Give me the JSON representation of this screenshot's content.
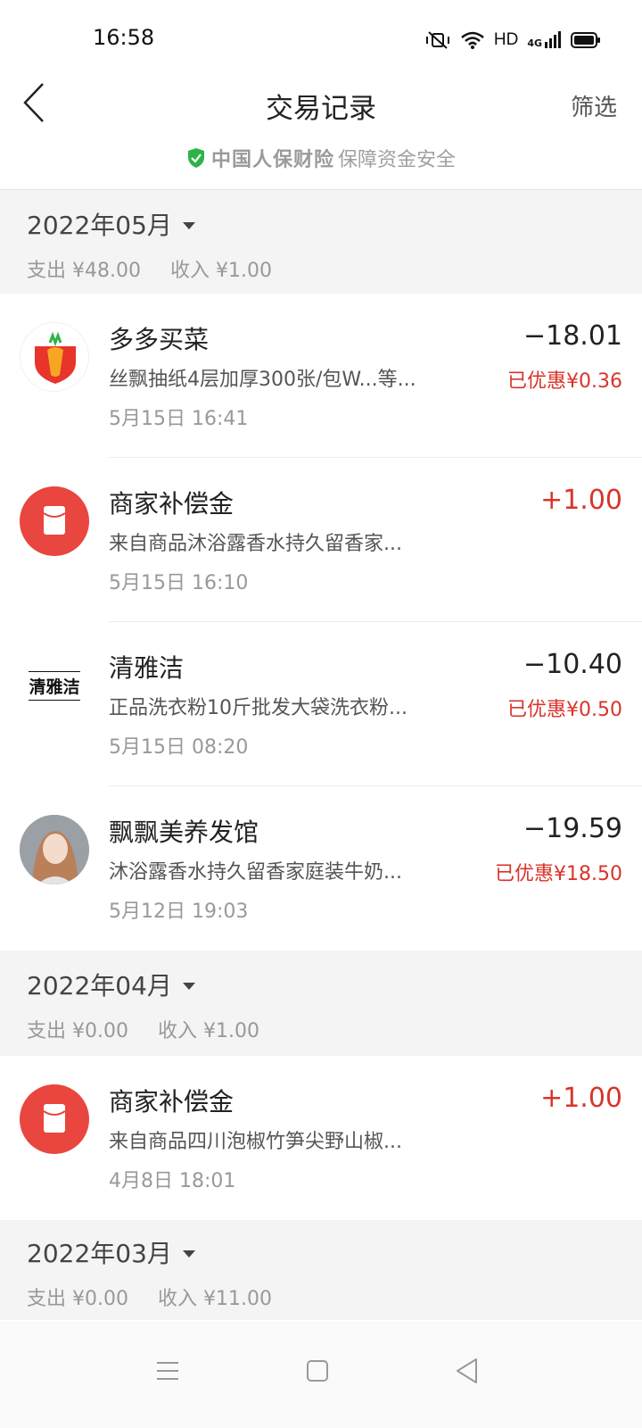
{
  "status": {
    "time": "16:58",
    "hd": "HD",
    "net": "4G"
  },
  "header": {
    "title": "交易记录",
    "filter": "筛选"
  },
  "security": {
    "brand": "中国人保财险",
    "note": "保障资金安全"
  },
  "months": [
    {
      "title": "2022年05月",
      "expense": "支出 ¥48.00",
      "income": "收入 ¥1.00",
      "items": [
        {
          "name": "多多买菜",
          "desc": "丝飘抽纸4层加厚300张/包W...等...",
          "time": "5月15日 16:41",
          "amount": "−18.01",
          "discount": "已优惠¥0.36"
        },
        {
          "name": "商家补偿金",
          "desc": "来自商品沐浴露香水持久留香家...",
          "time": "5月15日 16:10",
          "amount": "+1.00",
          "discount": ""
        },
        {
          "name": "清雅洁",
          "desc": "正品洗衣粉10斤批发大袋洗衣粉...",
          "time": "5月15日 08:20",
          "amount": "−10.40",
          "discount": "已优惠¥0.50",
          "logo_text": "清雅洁"
        },
        {
          "name": "飘飘美养发馆",
          "desc": "沐浴露香水持久留香家庭装牛奶...",
          "time": "5月12日 19:03",
          "amount": "−19.59",
          "discount": "已优惠¥18.50"
        }
      ]
    },
    {
      "title": "2022年04月",
      "expense": "支出 ¥0.00",
      "income": "收入 ¥1.00",
      "items": [
        {
          "name": "商家补偿金",
          "desc": "来自商品四川泡椒竹笋尖野山椒...",
          "time": "4月8日 18:01",
          "amount": "+1.00",
          "discount": ""
        }
      ]
    },
    {
      "title": "2022年03月",
      "expense": "支出 ¥0.00",
      "income": "收入 ¥11.00"
    }
  ],
  "colors": {
    "accent_red": "#d9342b",
    "shield_green": "#2db34a",
    "header_bg": "#f4f4f4"
  },
  "icons": {
    "back": "chevron-left-icon",
    "nav": [
      "menu-icon",
      "home-icon",
      "back-triangle-icon"
    ]
  }
}
